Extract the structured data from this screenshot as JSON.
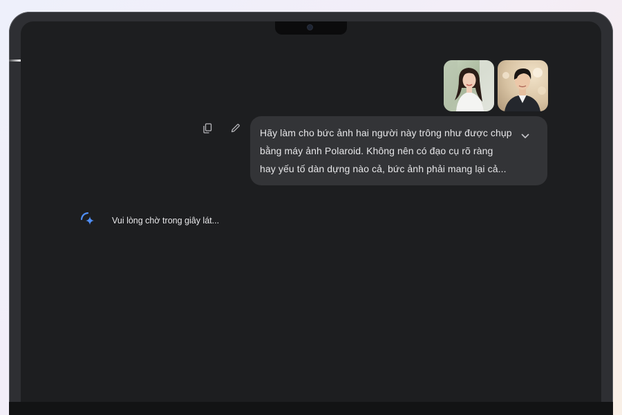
{
  "attachments": [
    {
      "alt": "Ảnh người phụ nữ",
      "icon": "photo-woman"
    },
    {
      "alt": "Ảnh người đàn ông",
      "icon": "photo-man"
    }
  ],
  "message": {
    "lines": [
      "Hãy làm cho bức ảnh hai người này trông như được chụp",
      "bằng máy ảnh Polaroid. Không nên có đạo cụ rõ ràng",
      "hay yếu tố dàn dựng nào cả, bức ảnh phải mang lại cả..."
    ],
    "actions": {
      "copy_icon": "copy-icon",
      "edit_icon": "pencil-icon",
      "expand_icon": "chevron-down-icon"
    }
  },
  "response": {
    "status": "Vui lòng chờ trong giây lát...",
    "icon": "sparkle-spinner-icon"
  },
  "colors": {
    "screen_bg": "#1d1e20",
    "bubble_bg": "#333437",
    "accent_blue": "#4f8ef7"
  }
}
